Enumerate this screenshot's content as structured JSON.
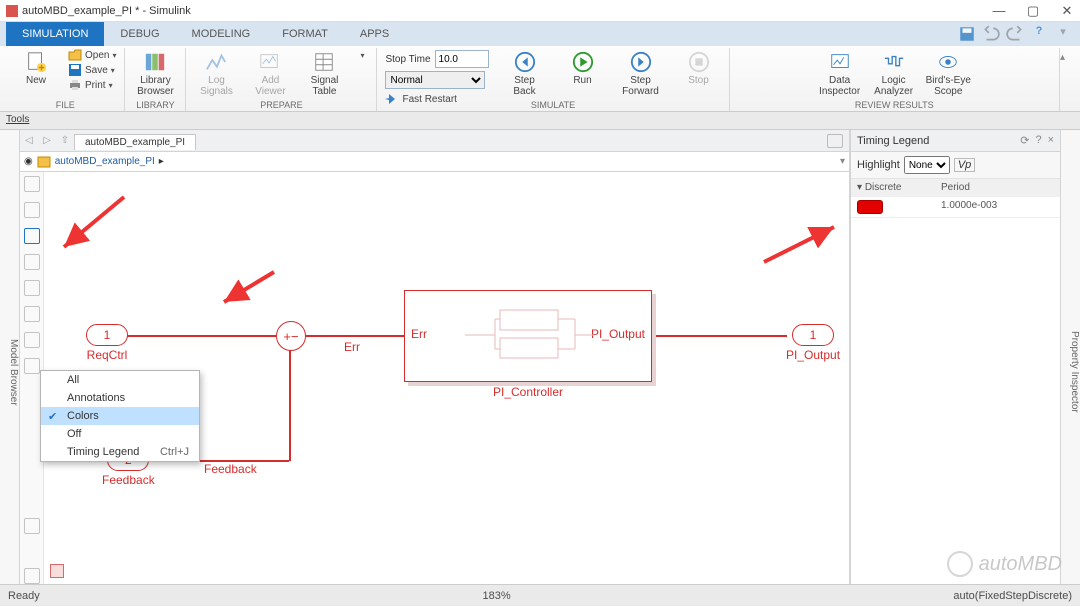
{
  "window": {
    "title": "autoMBD_example_PI * - Simulink"
  },
  "ribbon": {
    "tabs": [
      "SIMULATION",
      "DEBUG",
      "MODELING",
      "FORMAT",
      "APPS"
    ],
    "file": {
      "group": "FILE",
      "new": "New",
      "open": "Open",
      "save": "Save",
      "print": "Print"
    },
    "library": {
      "group": "LIBRARY",
      "browser": "Library\nBrowser"
    },
    "prepare": {
      "group": "PREPARE",
      "log": "Log\nSignals",
      "add": "Add\nViewer",
      "table": "Signal\nTable"
    },
    "simulate": {
      "group": "SIMULATE",
      "stop_time_label": "Stop Time",
      "stop_time_value": "10.0",
      "mode": "Normal",
      "fast_restart": "Fast Restart",
      "step_back": "Step\nBack",
      "run": "Run",
      "step_forward": "Step\nForward",
      "stop": "Stop"
    },
    "review": {
      "group": "REVIEW RESULTS",
      "data_inspector": "Data\nInspector",
      "logic": "Logic\nAnalyzer",
      "birds": "Bird's-Eye\nScope"
    }
  },
  "tools_label": "Tools",
  "modelbrowser": "Model Browser",
  "propinspector": "Property Inspector",
  "tab_name": "autoMBD_example_PI",
  "breadcrumb": "autoMBD_example_PI",
  "context_menu": {
    "items": [
      "All",
      "Annotations",
      "Colors",
      "Off",
      "Timing Legend"
    ],
    "shortcut": "Ctrl+J",
    "selected": "Colors"
  },
  "diagram": {
    "inport1": {
      "num": "1",
      "name": "ReqCtrl"
    },
    "inport2": {
      "num": "2",
      "name": "Feedback"
    },
    "sum": {
      "signs": "+−"
    },
    "err_label": "Err",
    "feedback_label": "Feedback",
    "subsystem": {
      "name": "PI_Controller",
      "in": "Err",
      "out": "PI_Output"
    },
    "outport": {
      "num": "1",
      "name": "PI_Output"
    }
  },
  "timing": {
    "title": "Timing Legend",
    "highlight_label": "Highlight",
    "highlight_value": "None",
    "col_group": "Discrete",
    "col_period": "Period",
    "period_value": "1.0000e-003"
  },
  "status": {
    "left": "Ready",
    "zoom": "183%",
    "right": "auto(FixedStepDiscrete)"
  },
  "watermark": "autoMBD"
}
